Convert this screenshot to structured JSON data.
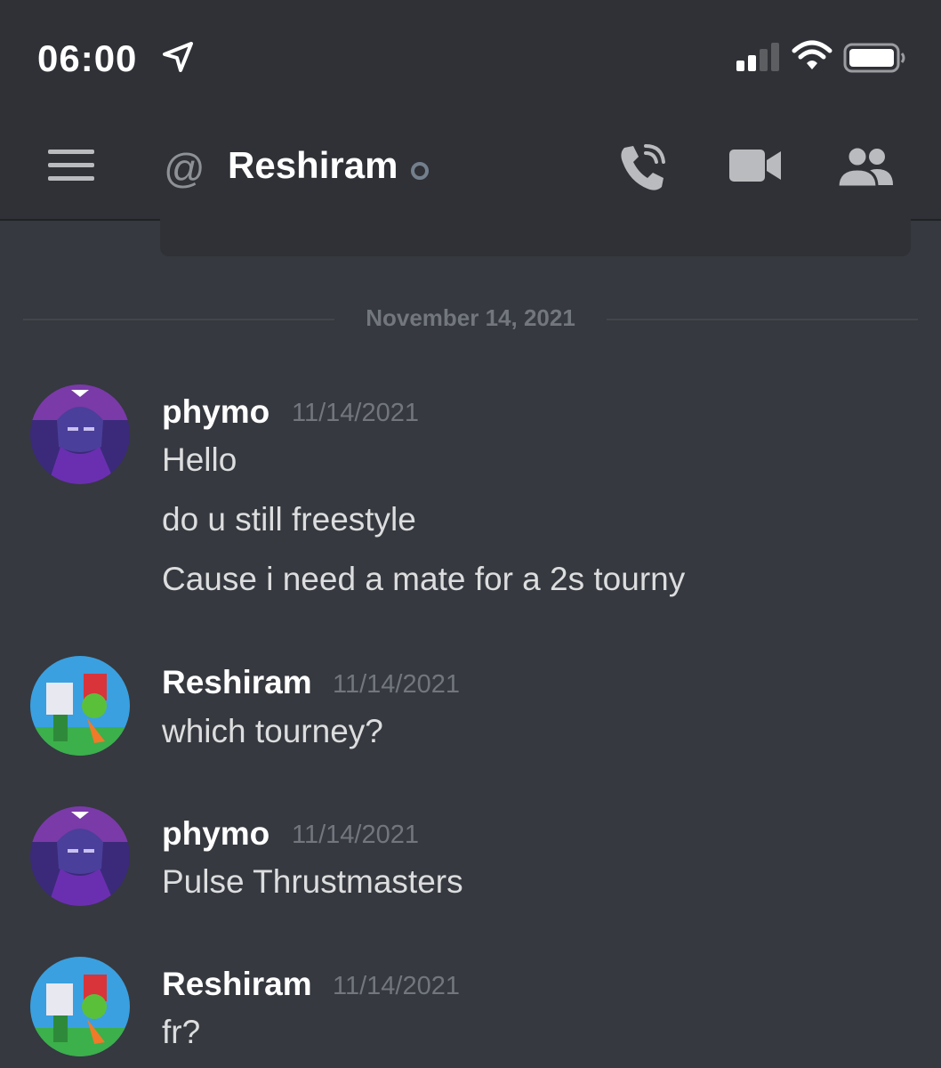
{
  "status_bar": {
    "time": "06:00",
    "icons": [
      "location-arrow-icon",
      "signal-icon",
      "wifi-icon",
      "battery-icon"
    ]
  },
  "header": {
    "at_symbol": "@",
    "channel_name": "Reshiram",
    "status": "offline",
    "icons": [
      "hamburger-icon",
      "voice-call-icon",
      "video-call-icon",
      "members-icon"
    ]
  },
  "divider": {
    "date": "November 14, 2021"
  },
  "messages": [
    {
      "author": "phymo",
      "timestamp": "11/14/2021",
      "lines": [
        "Hello",
        "do u still freestyle",
        "Cause i need a mate for a 2s tourny"
      ]
    },
    {
      "author": "Reshiram",
      "timestamp": "11/14/2021",
      "lines": [
        "which tourney?"
      ]
    },
    {
      "author": "phymo",
      "timestamp": "11/14/2021",
      "lines": [
        "Pulse Thrustmasters"
      ]
    },
    {
      "author": "Reshiram",
      "timestamp": "11/14/2021",
      "lines": [
        "fr?"
      ]
    }
  ],
  "colors": {
    "background": "#36393f",
    "header": "#2f3136",
    "muted": "#72767d",
    "text": "#dcddde",
    "author": "#ffffff"
  }
}
